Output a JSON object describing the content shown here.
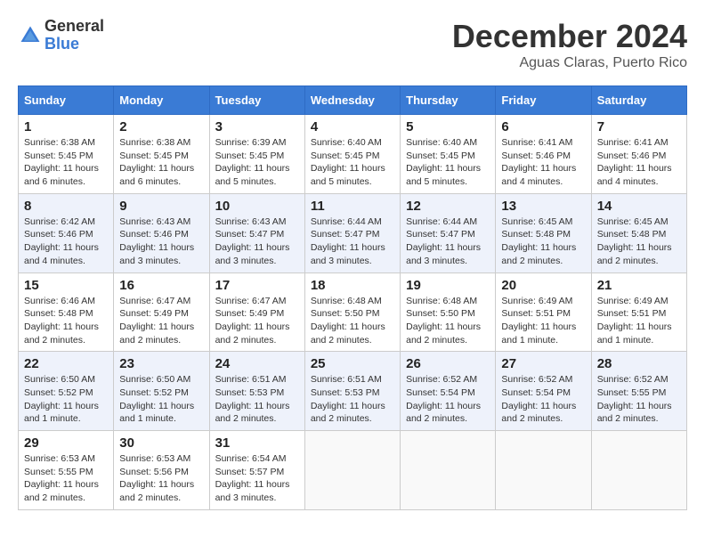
{
  "logo": {
    "general": "General",
    "blue": "Blue"
  },
  "title": "December 2024",
  "location": "Aguas Claras, Puerto Rico",
  "days_of_week": [
    "Sunday",
    "Monday",
    "Tuesday",
    "Wednesday",
    "Thursday",
    "Friday",
    "Saturday"
  ],
  "weeks": [
    [
      {
        "day": "1",
        "sunrise": "6:38 AM",
        "sunset": "5:45 PM",
        "daylight": "11 hours and 6 minutes."
      },
      {
        "day": "2",
        "sunrise": "6:38 AM",
        "sunset": "5:45 PM",
        "daylight": "11 hours and 6 minutes."
      },
      {
        "day": "3",
        "sunrise": "6:39 AM",
        "sunset": "5:45 PM",
        "daylight": "11 hours and 5 minutes."
      },
      {
        "day": "4",
        "sunrise": "6:40 AM",
        "sunset": "5:45 PM",
        "daylight": "11 hours and 5 minutes."
      },
      {
        "day": "5",
        "sunrise": "6:40 AM",
        "sunset": "5:45 PM",
        "daylight": "11 hours and 5 minutes."
      },
      {
        "day": "6",
        "sunrise": "6:41 AM",
        "sunset": "5:46 PM",
        "daylight": "11 hours and 4 minutes."
      },
      {
        "day": "7",
        "sunrise": "6:41 AM",
        "sunset": "5:46 PM",
        "daylight": "11 hours and 4 minutes."
      }
    ],
    [
      {
        "day": "8",
        "sunrise": "6:42 AM",
        "sunset": "5:46 PM",
        "daylight": "11 hours and 4 minutes."
      },
      {
        "day": "9",
        "sunrise": "6:43 AM",
        "sunset": "5:46 PM",
        "daylight": "11 hours and 3 minutes."
      },
      {
        "day": "10",
        "sunrise": "6:43 AM",
        "sunset": "5:47 PM",
        "daylight": "11 hours and 3 minutes."
      },
      {
        "day": "11",
        "sunrise": "6:44 AM",
        "sunset": "5:47 PM",
        "daylight": "11 hours and 3 minutes."
      },
      {
        "day": "12",
        "sunrise": "6:44 AM",
        "sunset": "5:47 PM",
        "daylight": "11 hours and 3 minutes."
      },
      {
        "day": "13",
        "sunrise": "6:45 AM",
        "sunset": "5:48 PM",
        "daylight": "11 hours and 2 minutes."
      },
      {
        "day": "14",
        "sunrise": "6:45 AM",
        "sunset": "5:48 PM",
        "daylight": "11 hours and 2 minutes."
      }
    ],
    [
      {
        "day": "15",
        "sunrise": "6:46 AM",
        "sunset": "5:48 PM",
        "daylight": "11 hours and 2 minutes."
      },
      {
        "day": "16",
        "sunrise": "6:47 AM",
        "sunset": "5:49 PM",
        "daylight": "11 hours and 2 minutes."
      },
      {
        "day": "17",
        "sunrise": "6:47 AM",
        "sunset": "5:49 PM",
        "daylight": "11 hours and 2 minutes."
      },
      {
        "day": "18",
        "sunrise": "6:48 AM",
        "sunset": "5:50 PM",
        "daylight": "11 hours and 2 minutes."
      },
      {
        "day": "19",
        "sunrise": "6:48 AM",
        "sunset": "5:50 PM",
        "daylight": "11 hours and 2 minutes."
      },
      {
        "day": "20",
        "sunrise": "6:49 AM",
        "sunset": "5:51 PM",
        "daylight": "11 hours and 1 minute."
      },
      {
        "day": "21",
        "sunrise": "6:49 AM",
        "sunset": "5:51 PM",
        "daylight": "11 hours and 1 minute."
      }
    ],
    [
      {
        "day": "22",
        "sunrise": "6:50 AM",
        "sunset": "5:52 PM",
        "daylight": "11 hours and 1 minute."
      },
      {
        "day": "23",
        "sunrise": "6:50 AM",
        "sunset": "5:52 PM",
        "daylight": "11 hours and 1 minute."
      },
      {
        "day": "24",
        "sunrise": "6:51 AM",
        "sunset": "5:53 PM",
        "daylight": "11 hours and 2 minutes."
      },
      {
        "day": "25",
        "sunrise": "6:51 AM",
        "sunset": "5:53 PM",
        "daylight": "11 hours and 2 minutes."
      },
      {
        "day": "26",
        "sunrise": "6:52 AM",
        "sunset": "5:54 PM",
        "daylight": "11 hours and 2 minutes."
      },
      {
        "day": "27",
        "sunrise": "6:52 AM",
        "sunset": "5:54 PM",
        "daylight": "11 hours and 2 minutes."
      },
      {
        "day": "28",
        "sunrise": "6:52 AM",
        "sunset": "5:55 PM",
        "daylight": "11 hours and 2 minutes."
      }
    ],
    [
      {
        "day": "29",
        "sunrise": "6:53 AM",
        "sunset": "5:55 PM",
        "daylight": "11 hours and 2 minutes."
      },
      {
        "day": "30",
        "sunrise": "6:53 AM",
        "sunset": "5:56 PM",
        "daylight": "11 hours and 2 minutes."
      },
      {
        "day": "31",
        "sunrise": "6:54 AM",
        "sunset": "5:57 PM",
        "daylight": "11 hours and 3 minutes."
      },
      null,
      null,
      null,
      null
    ]
  ],
  "labels": {
    "sunrise": "Sunrise:",
    "sunset": "Sunset:",
    "daylight": "Daylight hours"
  }
}
